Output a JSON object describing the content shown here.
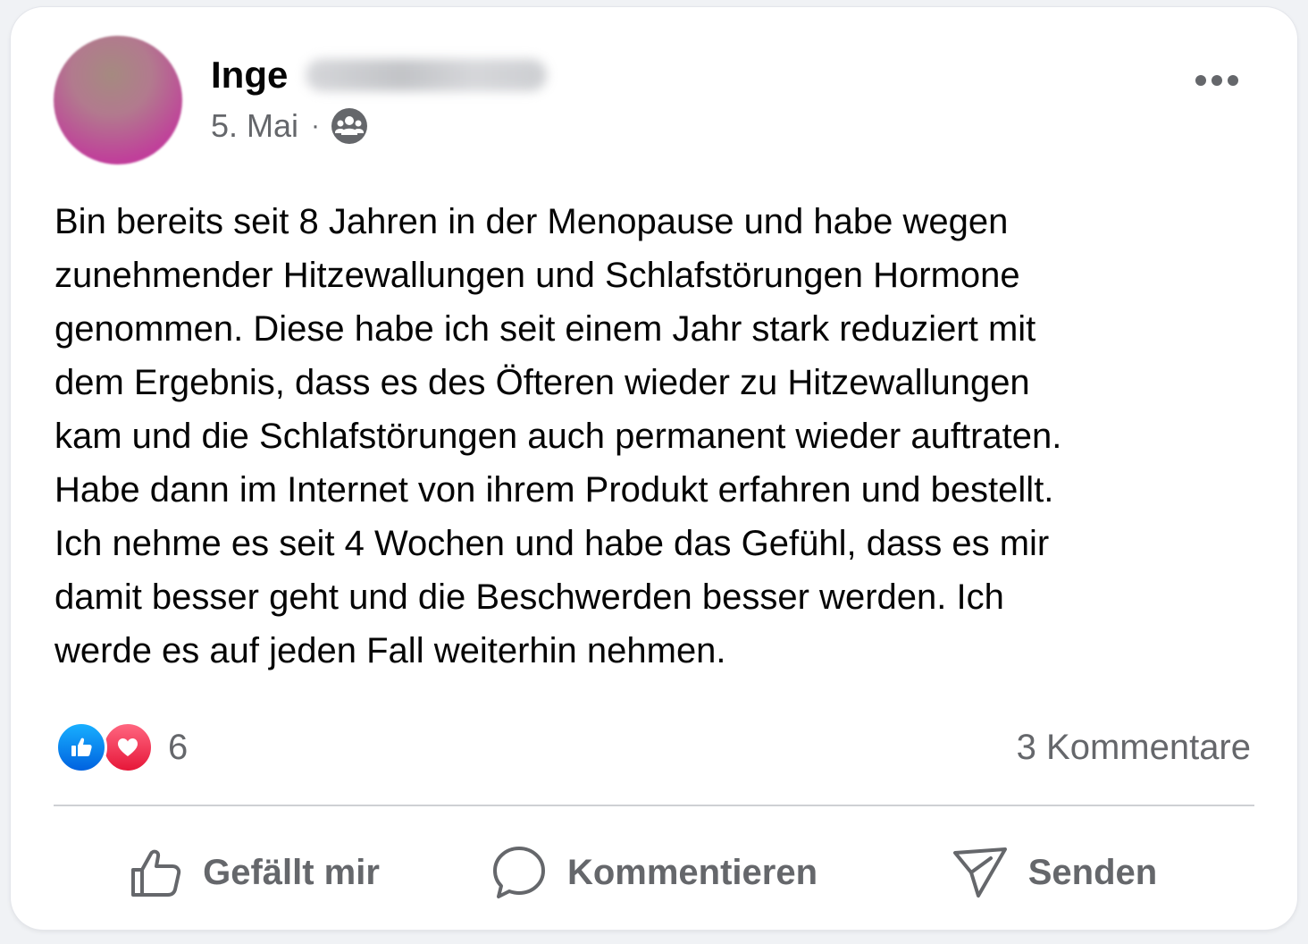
{
  "post": {
    "author_first_name": "Inge",
    "date": "5. Mai",
    "separator": "·",
    "audience_icon": "group-icon",
    "text": "Bin bereits seit 8 Jahren in der Menopause und habe wegen\nzunehmender Hitzewallungen und Schlafstörungen Hormone\ngenommen. Diese habe ich seit einem Jahr stark reduziert mit\ndem Ergebnis, dass es des Öfteren wieder zu Hitzewallungen\nkam und die Schlafstörungen auch permanent wieder auftraten.\nHabe dann im Internet von ihrem Produkt erfahren und bestellt.\nIch nehme es seit 4 Wochen und habe das Gefühl, dass es mir\ndamit besser geht und die Beschwerden besser werden. Ich\nwerde es auf jeden Fall weiterhin nehmen."
  },
  "reactions": {
    "icons": [
      "like-icon",
      "love-icon"
    ],
    "count": "6"
  },
  "comments": {
    "label": "3 Kommentare"
  },
  "actions": {
    "like_label": "Gefällt mir",
    "comment_label": "Kommentieren",
    "share_label": "Senden"
  },
  "colors": {
    "text_primary": "#050505",
    "text_secondary": "#65676b",
    "like_blue": "#0866ff",
    "love_red": "#f33e58",
    "divider": "#ced0d4"
  }
}
